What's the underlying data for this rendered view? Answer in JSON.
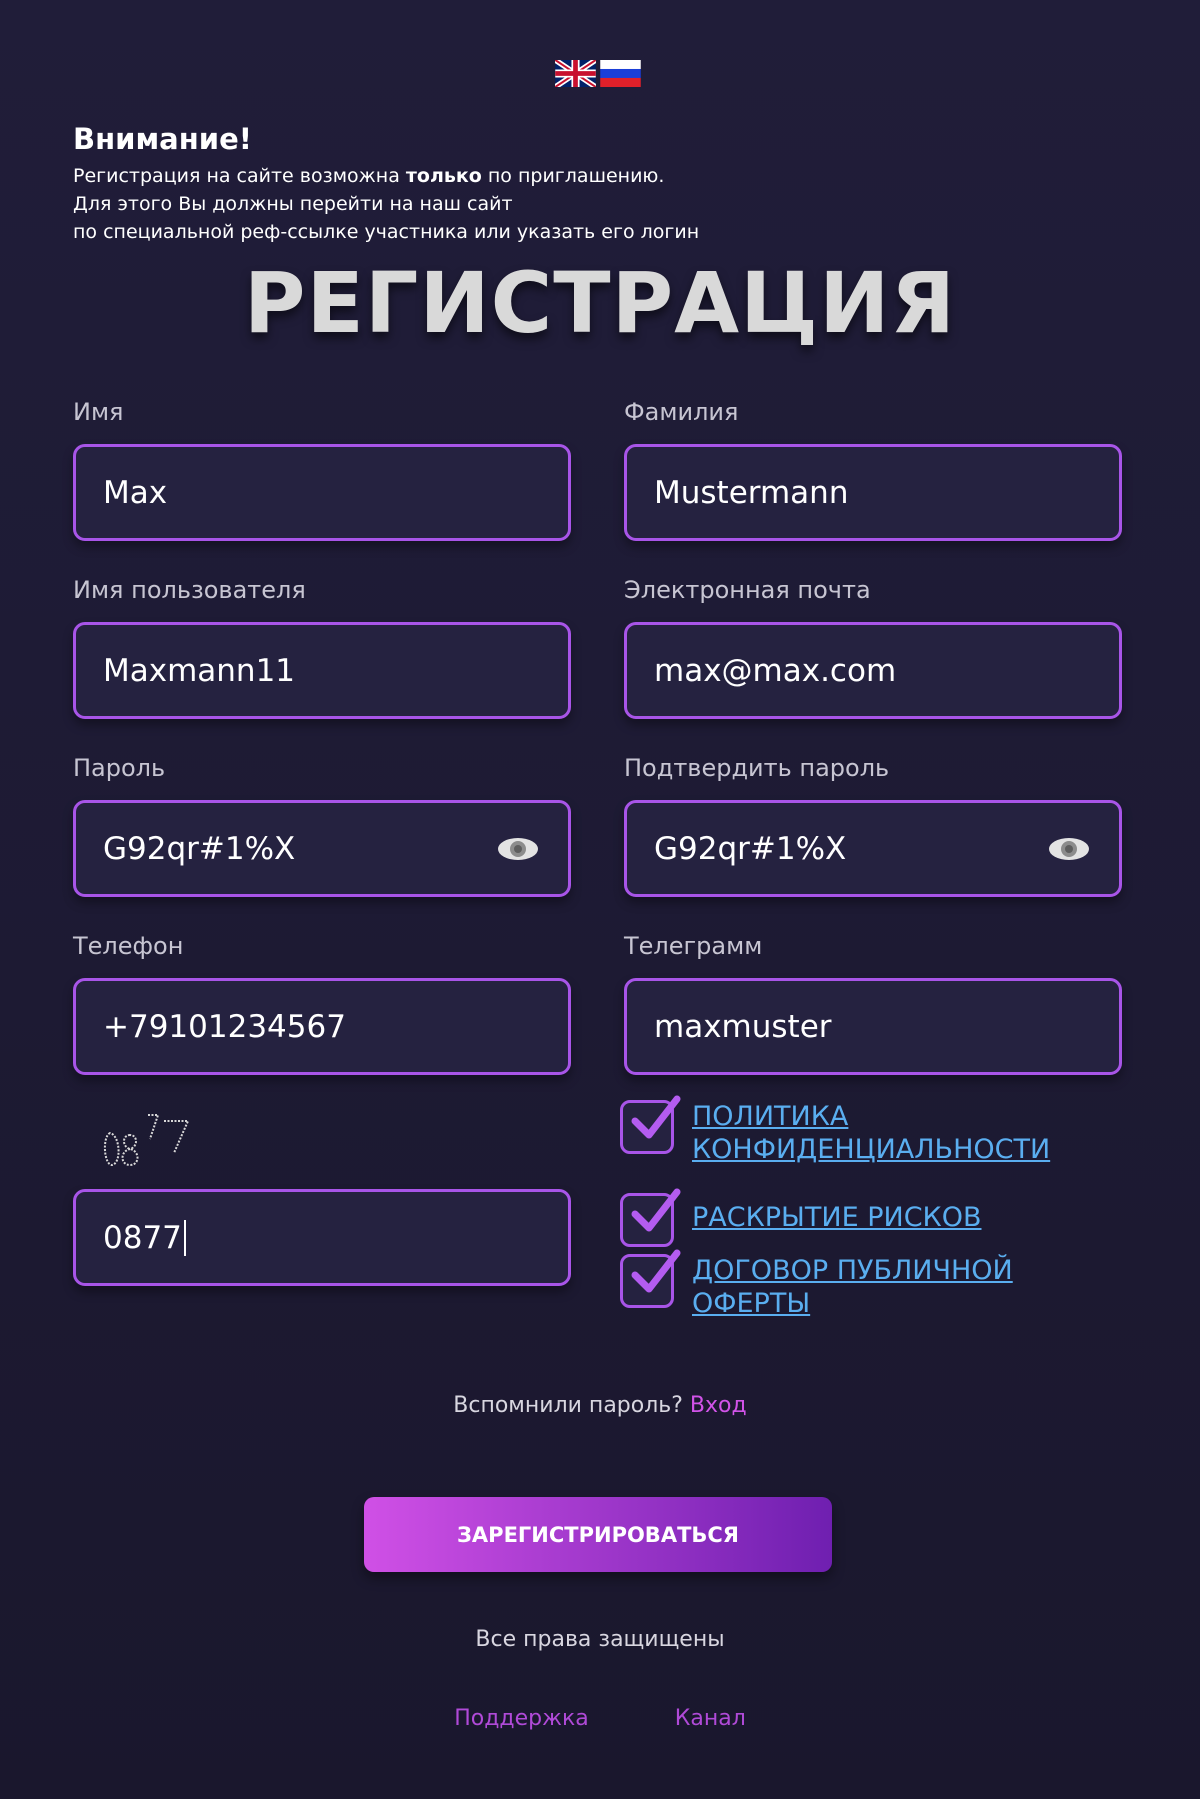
{
  "notice": {
    "title": "Внимание!",
    "line1_pre": "Регистрация на сайте возможна ",
    "line1_bold": "только",
    "line1_post": " по приглашению.",
    "line2": "Для этого Вы должны перейти на наш сайт",
    "line3": "по специальной реф-ссылке участника или указать его логин"
  },
  "page_title": "РЕГИСТРАЦИЯ",
  "fields": {
    "first_name": {
      "label": "Имя",
      "value": "Max"
    },
    "last_name": {
      "label": "Фамилия",
      "value": "Mustermann"
    },
    "username": {
      "label": "Имя пользователя",
      "value": "Maxmann11"
    },
    "email": {
      "label": "Электронная почта",
      "value": "max@max.com"
    },
    "password": {
      "label": "Пароль",
      "value": "G92qr#1%X"
    },
    "confirm_password": {
      "label": "Подтвердить пароль",
      "value": "G92qr#1%X"
    },
    "phone": {
      "label": "Телефон",
      "value": "+79101234567"
    },
    "telegram": {
      "label": "Телеграмм",
      "value": "maxmuster"
    },
    "captcha": {
      "value": "0877",
      "image_text": "0877"
    }
  },
  "agreements": {
    "privacy_line1": "ПОЛИТИКА",
    "privacy_line2": "КОНФИДЕНЦИАЛЬНОСТИ",
    "risks": "РАСКРЫТИЕ РИСКОВ",
    "offer_line1": "ДОГОВОР ПУБЛИЧНОЙ",
    "offer_line2": "ОФЕРТЫ",
    "checked": true
  },
  "remember": {
    "text": "Вспомнили пароль? ",
    "link": "Вход"
  },
  "submit_label": "ЗАРЕГИСТРИРОВАТЬСЯ",
  "copyright": "Все права защищены",
  "footer": {
    "support": "Поддержка",
    "channel": "Канал"
  },
  "colors": {
    "accent_border": "#a855e8",
    "link_blue": "#5aaef0",
    "link_pink": "#d153e8",
    "button_gradient_start": "#d050e6",
    "button_gradient_end": "#6f1fb0"
  },
  "icons": [
    "uk-flag-icon",
    "ru-flag-icon",
    "eye-icon",
    "checkmark-icon"
  ]
}
